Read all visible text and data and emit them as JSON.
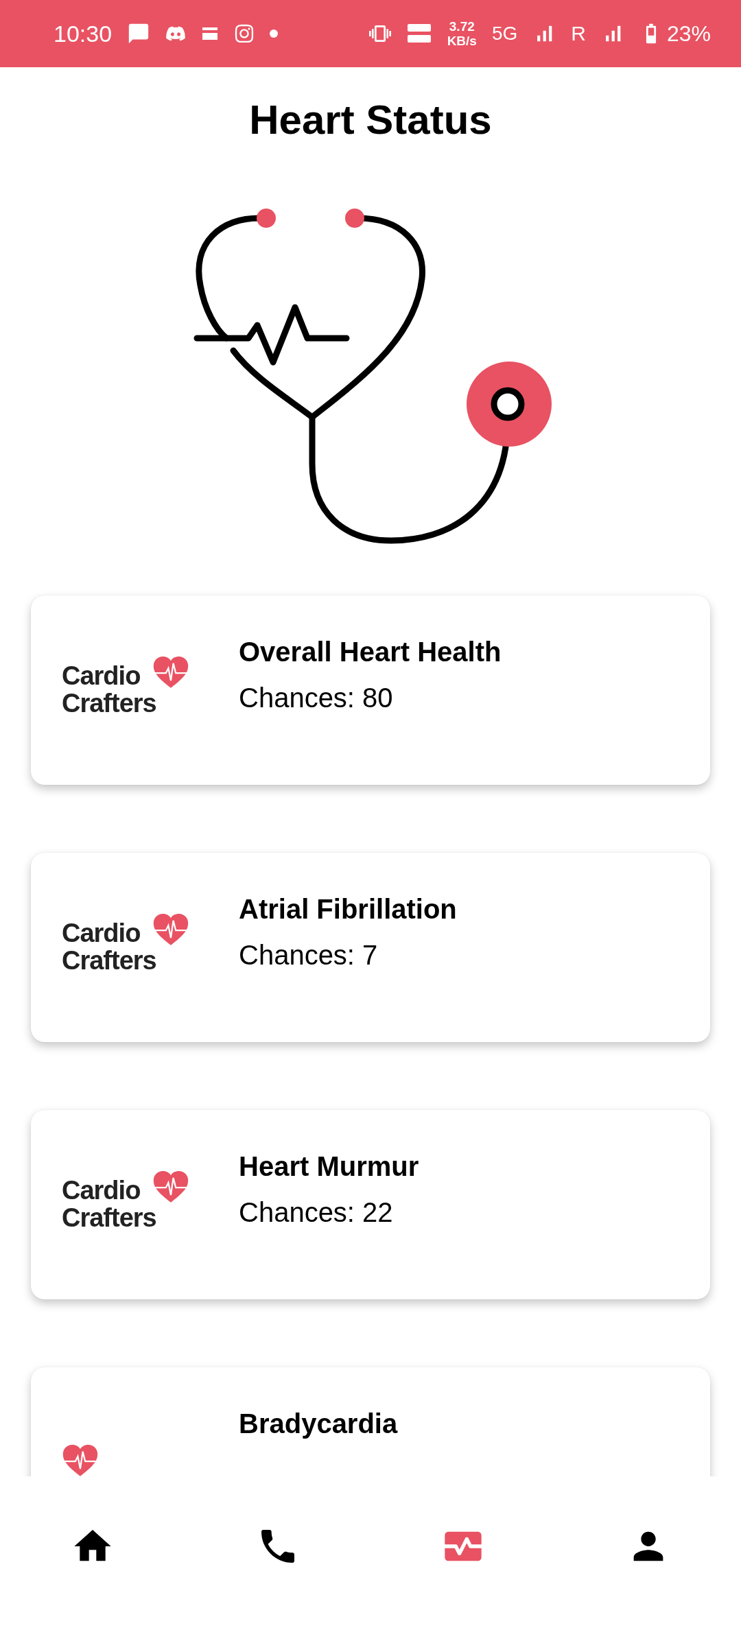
{
  "status_bar": {
    "time": "10:30",
    "speed_value": "3.72",
    "speed_unit": "KB/s",
    "network": "5G",
    "roaming": "R",
    "battery": "23%"
  },
  "title": "Heart Status",
  "cards": [
    {
      "logo": [
        "Cardio",
        "Crafters"
      ],
      "title": "Overall Heart Health",
      "chances": "Chances: 80"
    },
    {
      "logo": [
        "Cardio",
        "Crafters"
      ],
      "title": "Atrial Fibrillation",
      "chances": "Chances: 7"
    },
    {
      "logo": [
        "Cardio",
        "Crafters"
      ],
      "title": "Heart Murmur",
      "chances": "Chances: 22"
    },
    {
      "title": "Bradycardia"
    }
  ],
  "nav": [
    {
      "kind": "home",
      "selected": false
    },
    {
      "kind": "phone",
      "selected": false
    },
    {
      "kind": "heart",
      "selected": true
    },
    {
      "kind": "profile",
      "selected": false
    }
  ]
}
